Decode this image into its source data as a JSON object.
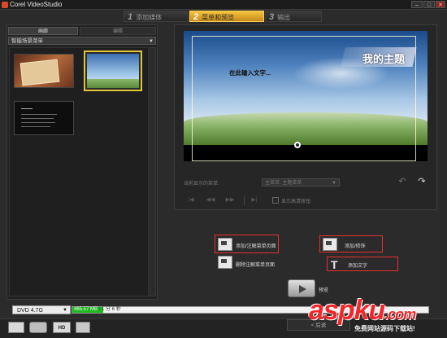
{
  "app": {
    "title": "Corel VideoStudio"
  },
  "window_controls": {
    "minimize": "–",
    "maximize": "□",
    "close": "✕"
  },
  "steps": [
    {
      "num": "1",
      "label": "添加媒体",
      "active": false
    },
    {
      "num": "2",
      "label": "菜单和预览",
      "active": true
    },
    {
      "num": "3",
      "label": "输出",
      "active": false
    }
  ],
  "left_panel": {
    "tabs": [
      "画廊",
      "编辑"
    ],
    "category": "智能场景菜单",
    "thumbnails": [
      "template-1",
      "template-2-selected",
      "template-3"
    ]
  },
  "preview": {
    "main_title": "我的主题",
    "sub_title": "在此输入文字...",
    "menu_label": "当前显示的菜单:",
    "menu_select": "主菜单: 主题菜单",
    "hd_checkbox_label": "显示高清按钮"
  },
  "actions": {
    "add_chapter": "添加/注解菜单页面",
    "delete_chapter": "删除注解菜单页面",
    "add_filter": "添加/修饰",
    "add_text": "添加文字",
    "preview": "预览"
  },
  "bottom": {
    "disc": "DVD 4.7G",
    "capacity_size": "465.57 MB",
    "capacity_time": "/ 1 分 6 秒",
    "capacity_percent": 8.6,
    "next": "< 后退"
  },
  "watermark": {
    "brand": "aspku",
    "tld": ".com",
    "slogan": "免费网站源码下载站!"
  },
  "colors": {
    "accent": "#e8b630",
    "highlight_box": "#e53030",
    "capacity_fill": "#1fb81f"
  }
}
